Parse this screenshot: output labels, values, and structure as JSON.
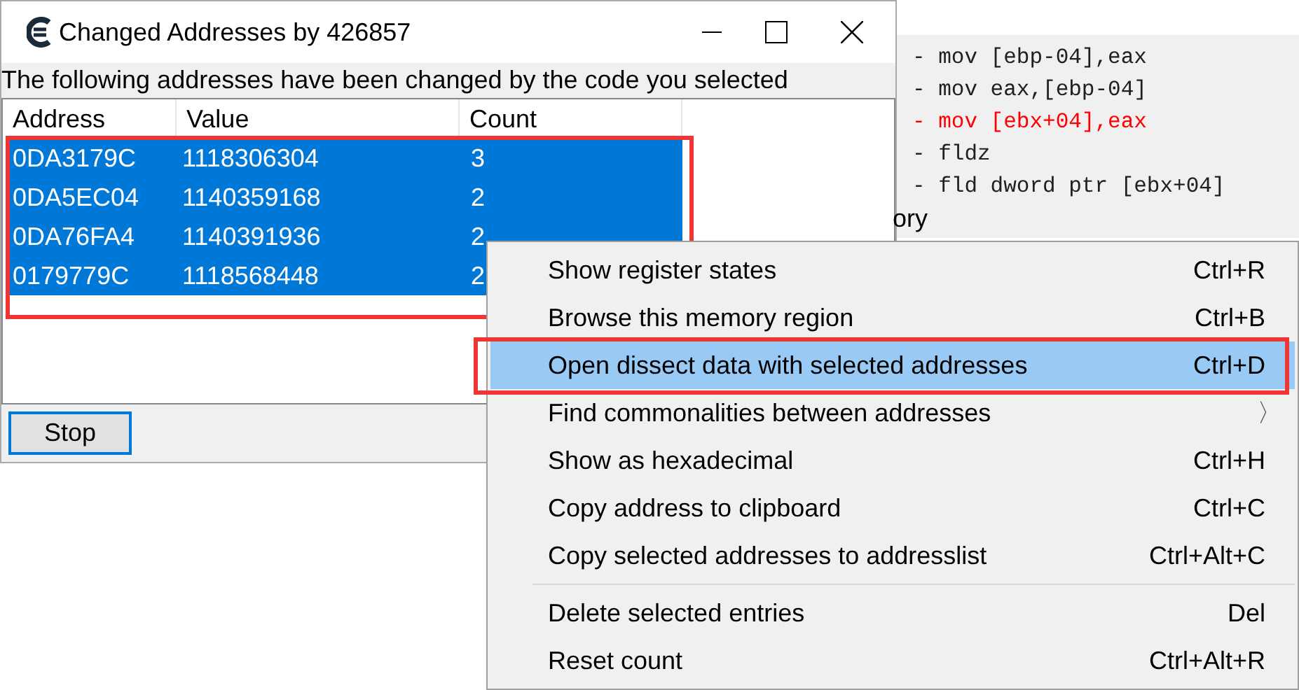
{
  "window": {
    "title": "Changed Addresses by 426857"
  },
  "message": "The following addresses have been changed by the code you selected",
  "table": {
    "columns": [
      "Address",
      "Value",
      "Count"
    ],
    "rows": [
      {
        "cells": [
          "0DA3179C",
          "1118306304",
          "3"
        ],
        "selected": true
      },
      {
        "cells": [
          "0DA5EC04",
          "1140359168",
          "2"
        ],
        "selected": true
      },
      {
        "cells": [
          "0DA76FA4",
          "1140391936",
          "2"
        ],
        "selected": true
      },
      {
        "cells": [
          "0179779C",
          "1118568448",
          "2"
        ],
        "selected": true
      }
    ]
  },
  "stop_button": "Stop",
  "code_lines": [
    {
      "text": "- mov [ebp-04],eax",
      "highlighted": false
    },
    {
      "text": "- mov eax,[ebp-04]",
      "highlighted": false
    },
    {
      "text": "- mov [ebx+04],eax",
      "highlighted": true
    },
    {
      "text": "- fldz",
      "highlighted": false
    },
    {
      "text": "- fld dword ptr [ebx+04]",
      "highlighted": false
    }
  ],
  "background_text": "ory",
  "context_menu": {
    "items": [
      {
        "label": "Show register states",
        "shortcut": "Ctrl+R",
        "selected": false
      },
      {
        "label": "Browse this memory region",
        "shortcut": "Ctrl+B",
        "selected": false
      },
      {
        "label": "Open dissect data with selected addresses",
        "shortcut": "Ctrl+D",
        "selected": true
      },
      {
        "label": "Find commonalities between addresses",
        "submenu": "〉",
        "selected": false
      },
      {
        "label": "Show as hexadecimal",
        "shortcut": "Ctrl+H",
        "selected": false
      },
      {
        "label": "Copy address to clipboard",
        "shortcut": "Ctrl+C",
        "selected": false
      },
      {
        "label": "Copy selected addresses to addresslist",
        "shortcut": "Ctrl+Alt+C",
        "selected": false
      },
      {
        "kind": "separator"
      },
      {
        "label": "Delete selected entries",
        "shortcut": "Del",
        "selected": false
      },
      {
        "label": "Reset count",
        "shortcut": "Ctrl+Alt+R",
        "selected": false
      }
    ]
  }
}
